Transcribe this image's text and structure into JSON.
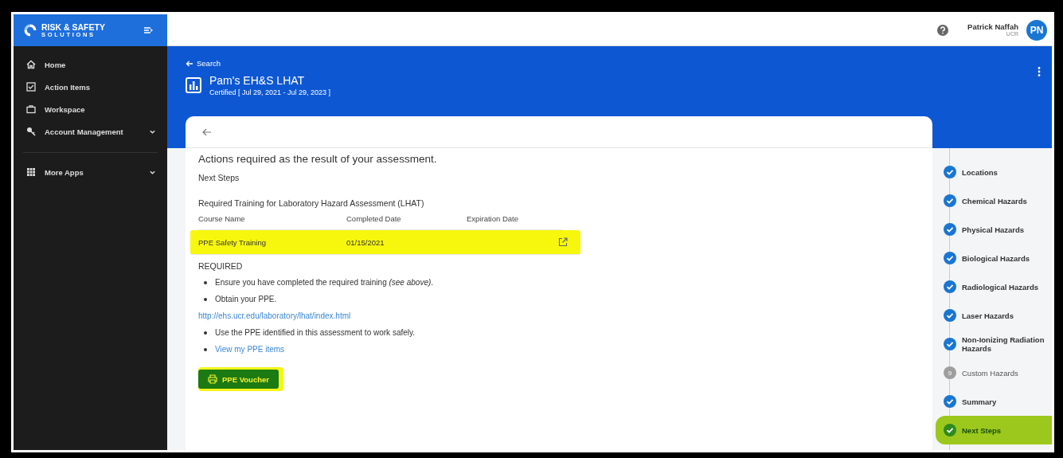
{
  "brand": {
    "line1": "RISK & SAFETY",
    "line2": "S O L U T I O N S"
  },
  "sidebar": {
    "items": [
      {
        "label": "Home",
        "expandable": false
      },
      {
        "label": "Action Items",
        "expandable": false
      },
      {
        "label": "Workspace",
        "expandable": false
      },
      {
        "label": "Account Management",
        "expandable": true
      },
      {
        "label": "More Apps",
        "expandable": true
      }
    ]
  },
  "user": {
    "name": "Patrick Naffah",
    "org": "UCR",
    "initials": "PN"
  },
  "header": {
    "back_link": "Search",
    "title": "Pam's EH&S LHAT",
    "subtitle": "Certified [ Jul 29, 2021 - Jul 29, 2023 ]"
  },
  "content": {
    "heading": "Actions required as the result of your assessment.",
    "section": "Next Steps",
    "table_title": "Required Training for Laboratory Hazard Assessment (LHAT)",
    "columns": [
      "Course Name",
      "Completed Date",
      "Expiration Date"
    ],
    "rows": [
      {
        "course": "PPE Safety Training",
        "completed": "01/15/2021",
        "highlighted": true
      }
    ],
    "required_label": "REQUIRED",
    "blocks": [
      {
        "kind": "bullet",
        "text": "Ensure you have completed the required training *(see above)*."
      },
      {
        "kind": "bullet",
        "text": "Obtain your PPE."
      },
      {
        "kind": "link",
        "text": "http://ehs.ucr.edu/laboratory/lhat/index.html"
      },
      {
        "kind": "bullet",
        "text": "Use the PPE identified in this assessment to work safely."
      },
      {
        "kind": "bullet_link",
        "text": "View my PPE items"
      }
    ],
    "button": {
      "label": "PPE Voucher",
      "highlighted": true
    }
  },
  "steps": [
    {
      "label": "Locations",
      "kind": "done",
      "selected": false
    },
    {
      "label": "Chemical Hazards",
      "kind": "done",
      "selected": false
    },
    {
      "label": "Physical Hazards",
      "kind": "done",
      "selected": false
    },
    {
      "label": "Biological Hazards",
      "kind": "done",
      "selected": false
    },
    {
      "label": "Radiological Hazards",
      "kind": "done",
      "selected": false
    },
    {
      "label": "Laser Hazards",
      "kind": "done",
      "selected": false
    },
    {
      "label": "Non-Ionizing Radiation Hazards",
      "kind": "done",
      "selected": false
    },
    {
      "label": "Custom Hazards",
      "kind": "pending",
      "number": "9",
      "selected": false
    },
    {
      "label": "Summary",
      "kind": "done",
      "selected": false
    },
    {
      "label": "Next Steps",
      "kind": "done",
      "selected": true
    }
  ]
}
